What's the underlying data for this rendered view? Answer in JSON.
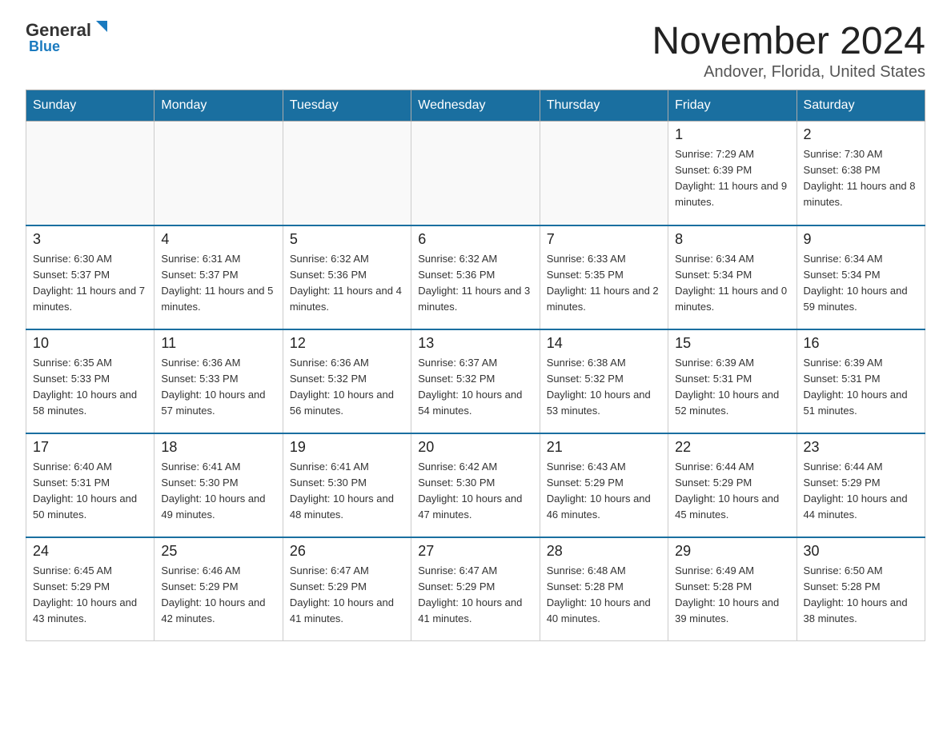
{
  "header": {
    "logo_general": "General",
    "logo_blue": "Blue",
    "month_title": "November 2024",
    "subtitle": "Andover, Florida, United States"
  },
  "weekdays": [
    "Sunday",
    "Monday",
    "Tuesday",
    "Wednesday",
    "Thursday",
    "Friday",
    "Saturday"
  ],
  "weeks": [
    [
      {
        "day": "",
        "info": ""
      },
      {
        "day": "",
        "info": ""
      },
      {
        "day": "",
        "info": ""
      },
      {
        "day": "",
        "info": ""
      },
      {
        "day": "",
        "info": ""
      },
      {
        "day": "1",
        "info": "Sunrise: 7:29 AM\nSunset: 6:39 PM\nDaylight: 11 hours and 9 minutes."
      },
      {
        "day": "2",
        "info": "Sunrise: 7:30 AM\nSunset: 6:38 PM\nDaylight: 11 hours and 8 minutes."
      }
    ],
    [
      {
        "day": "3",
        "info": "Sunrise: 6:30 AM\nSunset: 5:37 PM\nDaylight: 11 hours and 7 minutes."
      },
      {
        "day": "4",
        "info": "Sunrise: 6:31 AM\nSunset: 5:37 PM\nDaylight: 11 hours and 5 minutes."
      },
      {
        "day": "5",
        "info": "Sunrise: 6:32 AM\nSunset: 5:36 PM\nDaylight: 11 hours and 4 minutes."
      },
      {
        "day": "6",
        "info": "Sunrise: 6:32 AM\nSunset: 5:36 PM\nDaylight: 11 hours and 3 minutes."
      },
      {
        "day": "7",
        "info": "Sunrise: 6:33 AM\nSunset: 5:35 PM\nDaylight: 11 hours and 2 minutes."
      },
      {
        "day": "8",
        "info": "Sunrise: 6:34 AM\nSunset: 5:34 PM\nDaylight: 11 hours and 0 minutes."
      },
      {
        "day": "9",
        "info": "Sunrise: 6:34 AM\nSunset: 5:34 PM\nDaylight: 10 hours and 59 minutes."
      }
    ],
    [
      {
        "day": "10",
        "info": "Sunrise: 6:35 AM\nSunset: 5:33 PM\nDaylight: 10 hours and 58 minutes."
      },
      {
        "day": "11",
        "info": "Sunrise: 6:36 AM\nSunset: 5:33 PM\nDaylight: 10 hours and 57 minutes."
      },
      {
        "day": "12",
        "info": "Sunrise: 6:36 AM\nSunset: 5:32 PM\nDaylight: 10 hours and 56 minutes."
      },
      {
        "day": "13",
        "info": "Sunrise: 6:37 AM\nSunset: 5:32 PM\nDaylight: 10 hours and 54 minutes."
      },
      {
        "day": "14",
        "info": "Sunrise: 6:38 AM\nSunset: 5:32 PM\nDaylight: 10 hours and 53 minutes."
      },
      {
        "day": "15",
        "info": "Sunrise: 6:39 AM\nSunset: 5:31 PM\nDaylight: 10 hours and 52 minutes."
      },
      {
        "day": "16",
        "info": "Sunrise: 6:39 AM\nSunset: 5:31 PM\nDaylight: 10 hours and 51 minutes."
      }
    ],
    [
      {
        "day": "17",
        "info": "Sunrise: 6:40 AM\nSunset: 5:31 PM\nDaylight: 10 hours and 50 minutes."
      },
      {
        "day": "18",
        "info": "Sunrise: 6:41 AM\nSunset: 5:30 PM\nDaylight: 10 hours and 49 minutes."
      },
      {
        "day": "19",
        "info": "Sunrise: 6:41 AM\nSunset: 5:30 PM\nDaylight: 10 hours and 48 minutes."
      },
      {
        "day": "20",
        "info": "Sunrise: 6:42 AM\nSunset: 5:30 PM\nDaylight: 10 hours and 47 minutes."
      },
      {
        "day": "21",
        "info": "Sunrise: 6:43 AM\nSunset: 5:29 PM\nDaylight: 10 hours and 46 minutes."
      },
      {
        "day": "22",
        "info": "Sunrise: 6:44 AM\nSunset: 5:29 PM\nDaylight: 10 hours and 45 minutes."
      },
      {
        "day": "23",
        "info": "Sunrise: 6:44 AM\nSunset: 5:29 PM\nDaylight: 10 hours and 44 minutes."
      }
    ],
    [
      {
        "day": "24",
        "info": "Sunrise: 6:45 AM\nSunset: 5:29 PM\nDaylight: 10 hours and 43 minutes."
      },
      {
        "day": "25",
        "info": "Sunrise: 6:46 AM\nSunset: 5:29 PM\nDaylight: 10 hours and 42 minutes."
      },
      {
        "day": "26",
        "info": "Sunrise: 6:47 AM\nSunset: 5:29 PM\nDaylight: 10 hours and 41 minutes."
      },
      {
        "day": "27",
        "info": "Sunrise: 6:47 AM\nSunset: 5:29 PM\nDaylight: 10 hours and 41 minutes."
      },
      {
        "day": "28",
        "info": "Sunrise: 6:48 AM\nSunset: 5:28 PM\nDaylight: 10 hours and 40 minutes."
      },
      {
        "day": "29",
        "info": "Sunrise: 6:49 AM\nSunset: 5:28 PM\nDaylight: 10 hours and 39 minutes."
      },
      {
        "day": "30",
        "info": "Sunrise: 6:50 AM\nSunset: 5:28 PM\nDaylight: 10 hours and 38 minutes."
      }
    ]
  ]
}
